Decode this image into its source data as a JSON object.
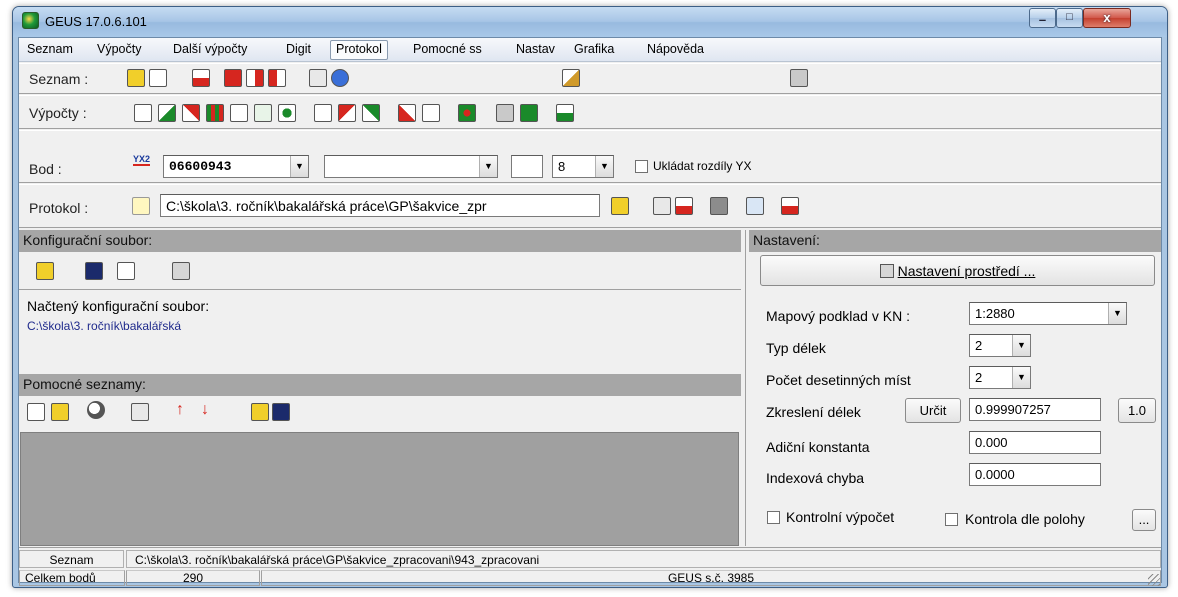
{
  "window": {
    "title": "GEUS 17.0.6.101",
    "controls": {
      "minimize": "–",
      "maximize": "□",
      "close": "x"
    }
  },
  "menu": [
    "Seznam",
    "Výpočty",
    "Další výpočty",
    "Digit",
    "Protokol",
    "Pomocné ss",
    "Nastav",
    "Grafika",
    "Nápověda"
  ],
  "menu_active_index": 4,
  "rows": {
    "seznam_label": "Seznam :",
    "vypocty_label": "Výpočty :",
    "bod": {
      "label": "Bod :",
      "yx_icon": "YX2",
      "point_number": "06600943",
      "second_value": "",
      "small_value": "",
      "digits_value": "8",
      "checkbox_label": "Ukládat rozdíly YX"
    },
    "protokol": {
      "label": "Protokol :",
      "path": "C:\\škola\\3. ročník\\bakalářská práce\\GP\\šakvice_zpr"
    }
  },
  "config_panel": {
    "header": "Konfigurační soubor:",
    "loaded_label": "Načtený konfigurační soubor:",
    "loaded_path": "C:\\škola\\3. ročník\\bakalářská"
  },
  "lists_panel": {
    "header": "Pomocné seznamy:"
  },
  "settings_panel": {
    "header": "Nastavení:",
    "env_button": "Nastavení prostředí ...",
    "map_label": "Mapový podklad v KN :",
    "map_value": "1:2880",
    "length_type_label": "Typ délek",
    "length_type_value": "2",
    "decimals_label": "Počet desetinných míst",
    "decimals_value": "2",
    "distortion_label": "Zkreslení délek",
    "determine_button": "Určit",
    "distortion_value": "0.999907257",
    "reset_button": "1.0",
    "additive_label": "Adiční konstanta",
    "additive_value": "0.000",
    "index_label": "Indexová chyba",
    "index_value": "0.0000",
    "control_calc_label": "Kontrolní výpočet",
    "control_pos_label": "Kontrola dle polohy",
    "dots_button": "..."
  },
  "status": {
    "row1_label": "Seznam",
    "row1_path": "C:\\škola\\3. ročník\\bakalářská práce\\GP\\šakvice_zpracovani\\943_zpracovani",
    "row2_label": "Celkem bodů",
    "row2_count": "290",
    "row2_info": "GEUS s.č. 3985"
  },
  "colors": {
    "window_frame": "#a9c6e3",
    "client_bg": "#f0f0f0",
    "panel_header": "#a6a6a6",
    "path_text": "#1f2a8c",
    "icon_red": "#d6261f",
    "icon_green": "#1a8a2a",
    "icon_yellow": "#f1cf2a"
  },
  "icons": {
    "seznam_toolbar": [
      "open-folder-icon",
      "new-document-icon",
      "list-export-icon",
      "list-red-icon",
      "list-arrow-icon",
      "list-play-icon",
      "open-book-icon",
      "info-icon",
      "edit-pencil-icon",
      "person-stand-icon"
    ],
    "vypocty_toolbar": [
      "calc-cross-icon",
      "calc-angle-icon",
      "calc-intersect-icon",
      "calc-grid-icon",
      "calc-x-icon",
      "calc-21-icon",
      "calc-dot-icon",
      "calc-step-icon",
      "calc-triangle-icon",
      "calc-polyline-icon",
      "calc-red-angle-icon",
      "calc-net-icon",
      "calc-star-icon",
      "calc-calendar-icon",
      "calc-gear-icon",
      "calc-blocks-icon"
    ],
    "protokol_toolbar": [
      "open-folder-icon",
      "report-icon",
      "report-red-icon",
      "print-icon",
      "clipboard-icon",
      "save-report-icon"
    ],
    "config_toolbar": [
      "open-folder-icon",
      "save-disk-icon",
      "save-as-disk-icon",
      "settings-tool-icon"
    ],
    "lists_toolbar": [
      "copy-list-icon",
      "paste-list-icon",
      "zoom-icon",
      "pages-icon",
      "arrow-up-icon",
      "arrow-down-icon",
      "open-folder-icon",
      "save-disk-icon"
    ]
  }
}
